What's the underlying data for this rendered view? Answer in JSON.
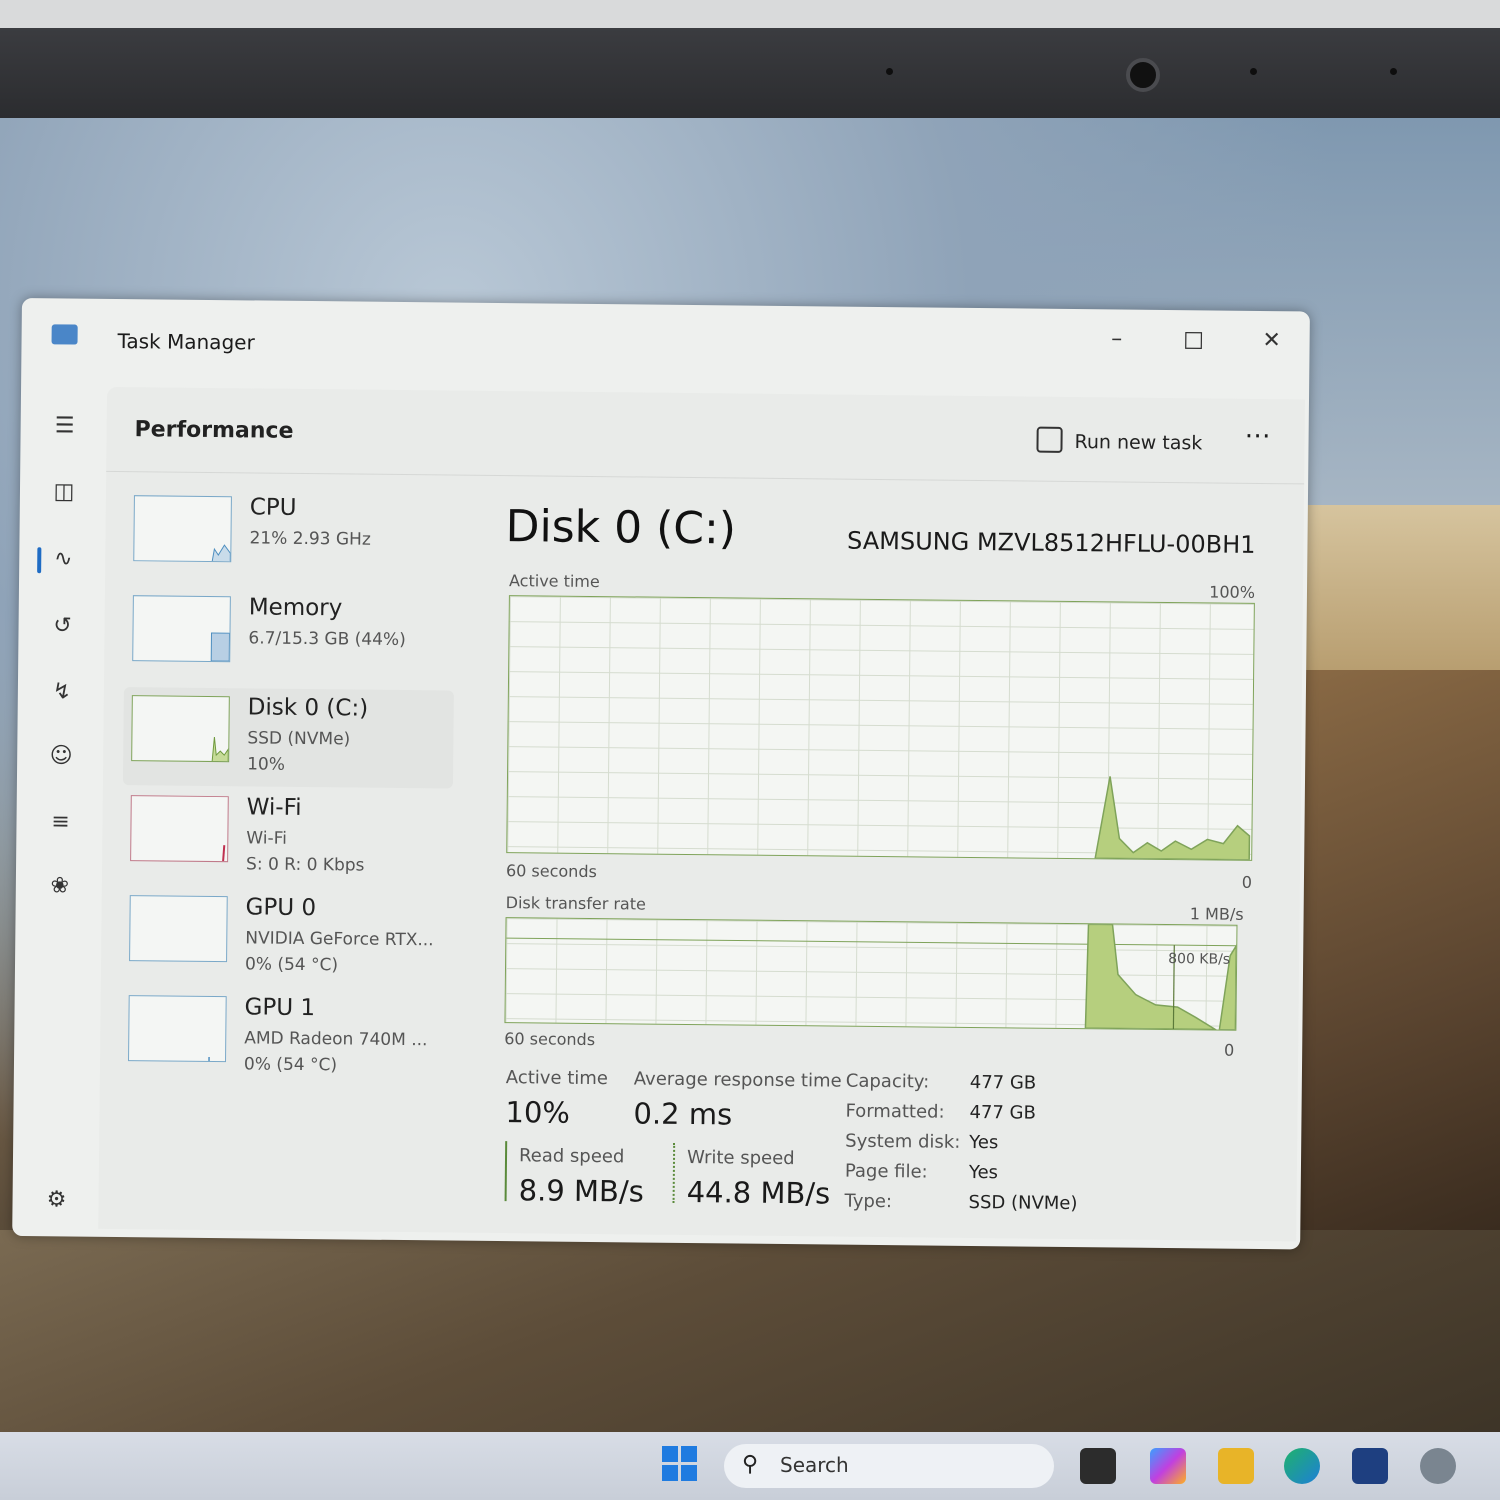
{
  "window": {
    "title": "Task Manager"
  },
  "header": {
    "title": "Performance",
    "run_new_task": "Run new task"
  },
  "devices": [
    {
      "name": "CPU",
      "line1": "21% 2.93 GHz",
      "line2": ""
    },
    {
      "name": "Memory",
      "line1": "6.7/15.3 GB (44%)",
      "line2": ""
    },
    {
      "name": "Disk 0 (C:)",
      "line1": "SSD (NVMe)",
      "line2": "10%"
    },
    {
      "name": "Wi-Fi",
      "line1": "Wi-Fi",
      "line2": "S: 0 R: 0 Kbps"
    },
    {
      "name": "GPU 0",
      "line1": "NVIDIA GeForce RTX...",
      "line2": "0% (54 °C)"
    },
    {
      "name": "GPU 1",
      "line1": "AMD Radeon 740M ...",
      "line2": "0% (54 °C)"
    }
  ],
  "detail": {
    "title": "Disk 0 (C:)",
    "model": "SAMSUNG MZVL8512HFLU-00BH1",
    "active_graph": {
      "label": "Active time",
      "max": "100%",
      "xlabel": "60 seconds",
      "min": "0"
    },
    "transfer_graph": {
      "label": "Disk transfer rate",
      "max": "1 MB/s",
      "mid": "800 KB/s",
      "xlabel": "60 seconds",
      "min": "0"
    },
    "stats": {
      "active_time_label": "Active time",
      "active_time": "10%",
      "avg_resp_label": "Average response time",
      "avg_resp": "0.2 ms",
      "read_label": "Read speed",
      "read": "8.9 MB/s",
      "write_label": "Write speed",
      "write": "44.8 MB/s"
    },
    "props": [
      {
        "k": "Capacity:",
        "v": "477 GB"
      },
      {
        "k": "Formatted:",
        "v": "477 GB"
      },
      {
        "k": "System disk:",
        "v": "Yes"
      },
      {
        "k": "Page file:",
        "v": "Yes"
      },
      {
        "k": "Type:",
        "v": "SSD (NVMe)"
      }
    ]
  },
  "taskbar": {
    "search_placeholder": "Search"
  },
  "colors": {
    "graph_fill": "#b6cf7e",
    "graph_line": "#7fa35a",
    "accent": "#1f6cc4"
  }
}
